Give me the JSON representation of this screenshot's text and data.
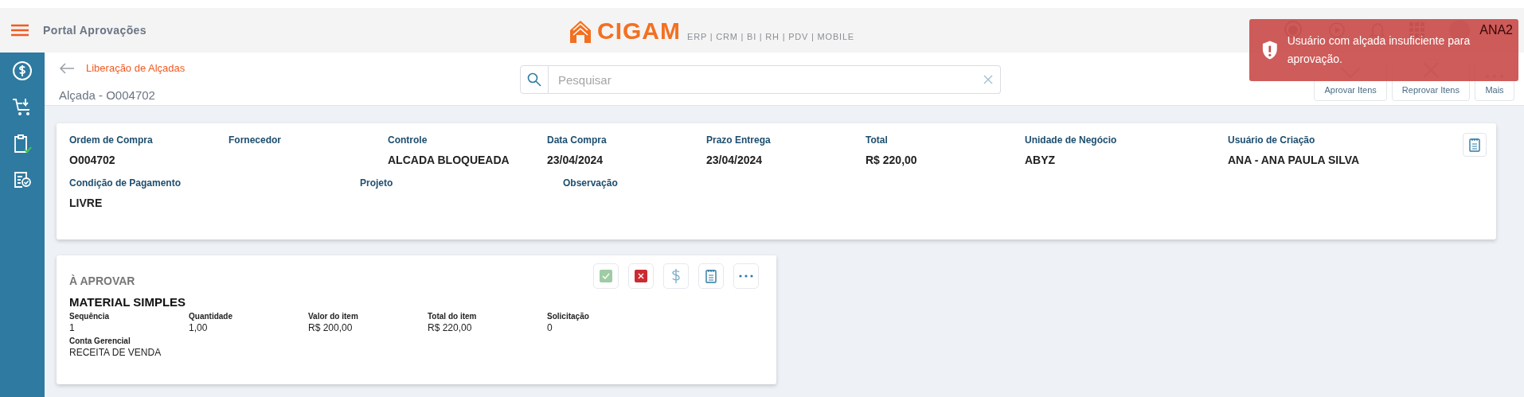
{
  "header": {
    "title": "Portal Aprovações",
    "brand": "CIGAM",
    "tagline": "ERP | CRM | BI | RH | PDV | MOBILE",
    "user": "ANA2",
    "icons": [
      {
        "kind": "headset"
      },
      {
        "kind": "play"
      },
      {
        "kind": "bell"
      },
      {
        "kind": "apps"
      },
      {
        "kind": "avatar"
      }
    ]
  },
  "sidebar": {
    "items": [
      {
        "kind": "money"
      },
      {
        "kind": "cart"
      },
      {
        "kind": "clipboard"
      },
      {
        "kind": "checklist"
      }
    ]
  },
  "page": {
    "back_link": "Liberação de Alçadas",
    "title": "Alçada - O004702"
  },
  "search": {
    "placeholder": "Pesquisar"
  },
  "toolbar": [
    {
      "kind": "approve",
      "label": "Aprovar Itens"
    },
    {
      "kind": "reject",
      "label": "Reprovar Itens"
    },
    {
      "kind": "more",
      "label": "Mais"
    }
  ],
  "order": {
    "fields": [
      {
        "label": "Ordem de Compra",
        "value": "O004702"
      },
      {
        "label": "Fornecedor"
      },
      {
        "label": "Controle",
        "value": "ALCADA BLOQUEADA"
      },
      {
        "label": "Data Compra",
        "value": "23/04/2024"
      },
      {
        "label": "Prazo Entrega",
        "value": "23/04/2024"
      },
      {
        "label": "Total",
        "value": "R$ 220,00"
      },
      {
        "label": "Unidade de Negócio",
        "value": "ABYZ"
      },
      {
        "label": "Usuário de Criação",
        "value": "ANA - ANA PAULA SILVA"
      }
    ],
    "extra_fields": [
      {
        "label": "Condição de Pagamento",
        "value": "LIVRE"
      },
      {
        "label": "Projeto"
      },
      {
        "label": "Observação"
      }
    ]
  },
  "item": {
    "status": "À APROVAR",
    "name": "MATERIAL SIMPLES",
    "actions": [
      {
        "kind": "approve"
      },
      {
        "kind": "reject"
      },
      {
        "kind": "price"
      },
      {
        "kind": "notes"
      },
      {
        "kind": "more"
      }
    ],
    "fields": [
      [
        {
          "label": "Sequência",
          "value": "1"
        },
        {
          "label": "Quantidade",
          "value": "1,00"
        },
        {
          "label": "Valor do item",
          "value": "R$ 200,00"
        },
        {
          "label": "Total do item",
          "value": "R$ 220,00"
        },
        {
          "label": "Solicitação",
          "value": "0"
        }
      ],
      [
        {
          "label": "Conta Gerencial",
          "value": "RECEITA DE VENDA"
        }
      ]
    ]
  },
  "toast": {
    "message": "Usuário com alçada insuficiente para aprovação."
  }
}
